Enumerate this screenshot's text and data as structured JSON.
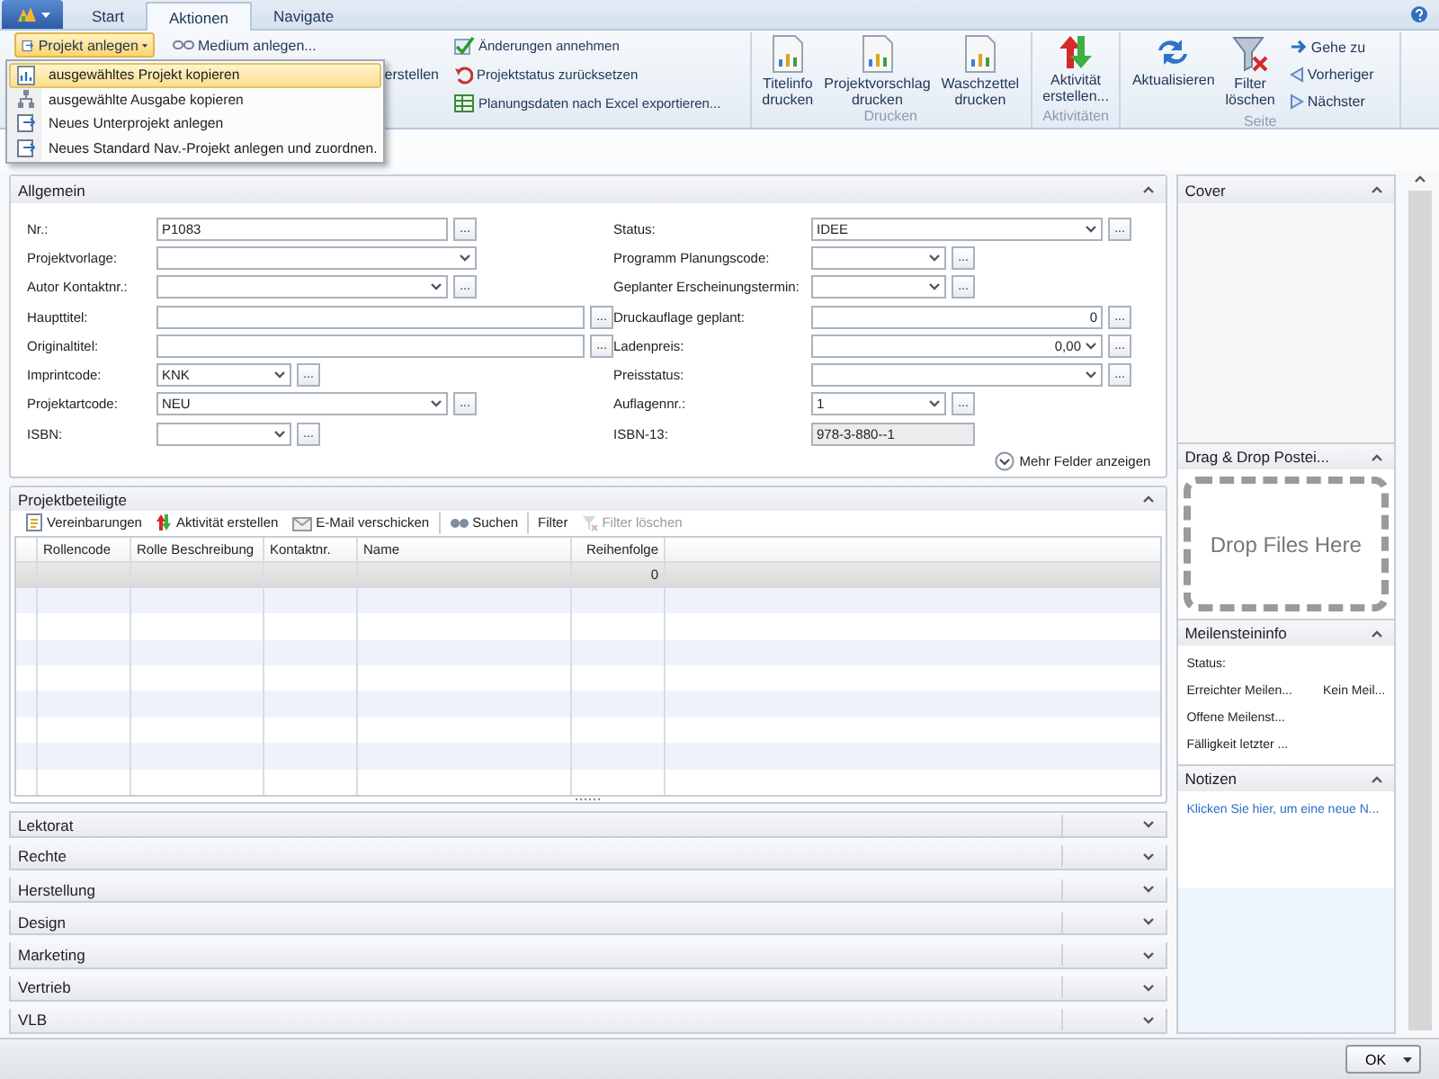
{
  "app_tabs": [
    {
      "label": "Start",
      "selected": false
    },
    {
      "label": "Aktionen",
      "selected": true
    },
    {
      "label": "Navigate",
      "selected": false
    }
  ],
  "ribbon": {
    "small_columns": [
      [
        {
          "label": "Projekt anlegen",
          "kind": "new-project",
          "highlighted": true
        }
      ],
      [
        {
          "label": "Medium anlegen...",
          "kind": "medium"
        },
        {
          "label": "erstellen",
          "kind": "text"
        }
      ],
      [
        {
          "label": "Änderungen annehmen",
          "kind": "accept"
        },
        {
          "label": "Projektstatus zurücksetzen",
          "kind": "reset"
        },
        {
          "label": "Planungsdaten nach Excel exportieren...",
          "kind": "excel"
        }
      ]
    ],
    "groups": [
      {
        "label": "Drucken",
        "items": [
          {
            "lines": [
              "Titelinfo",
              "drucken"
            ],
            "kind": "report"
          },
          {
            "lines": [
              "Projektvorschlag",
              "drucken"
            ],
            "kind": "report"
          },
          {
            "lines": [
              "Waschzettel",
              "drucken"
            ],
            "kind": "report"
          }
        ]
      },
      {
        "label": "Aktivitäten",
        "items": [
          {
            "lines": [
              "Aktivität",
              "erstellen..."
            ],
            "kind": "activity"
          }
        ]
      },
      {
        "label": "Seite",
        "items": [
          {
            "lines": [
              "Aktualisieren"
            ],
            "kind": "refresh"
          },
          {
            "lines": [
              "Filter",
              "löschen"
            ],
            "kind": "filter"
          }
        ],
        "small": [
          {
            "label": "Gehe zu",
            "kind": "goto"
          },
          {
            "label": "Vorheriger",
            "kind": "prev"
          },
          {
            "label": "Nächster",
            "kind": "next"
          }
        ]
      }
    ]
  },
  "menu": [
    {
      "label": "ausgewähltes Projekt kopieren",
      "kind": "copy",
      "highlighted": true
    },
    {
      "label": "ausgewählte Ausgabe kopieren",
      "kind": "tree",
      "highlighted": false
    },
    {
      "label": "Neues Unterprojekt anlegen",
      "kind": "new",
      "highlighted": false
    },
    {
      "label": "Neues Standard Nav.-Projekt anlegen und zuordnen.",
      "kind": "new",
      "highlighted": false
    }
  ],
  "sections": [
    {
      "kind": "form",
      "title": "Allgemein",
      "expanded": true,
      "left": [
        {
          "label": "Nr.:",
          "kind": "text",
          "value": "P1083",
          "lookup": "..."
        },
        {
          "label": "Projektvorlage:",
          "kind": "dropdown"
        },
        {
          "label": "Autor Kontaktnr.:",
          "kind": "dropdown",
          "lookup": "..."
        },
        {
          "label": "Haupttitel:",
          "kind": "text",
          "lookup": "..."
        },
        {
          "label": "Originaltitel:",
          "kind": "text",
          "lookup": "..."
        },
        {
          "label": "Imprintcode:",
          "kind": "dropdown",
          "value": "KNK",
          "lookup": "..."
        },
        {
          "label": "Projektartcode:",
          "kind": "dropdown",
          "value": "NEU",
          "lookup": "..."
        },
        {
          "label": "ISBN:",
          "kind": "dropdown",
          "lookup": "..."
        }
      ],
      "right": [
        {
          "label": "Status:",
          "kind": "dropdown",
          "value": "IDEE",
          "lookup": "..."
        },
        {
          "label": "Programm Planungscode:",
          "kind": "dropdown",
          "lookup": "..."
        },
        {
          "label": "Geplanter Erscheinungstermin:",
          "kind": "dropdown",
          "lookup": "..."
        },
        {
          "label": "Druckauflage geplant:",
          "kind": "text",
          "value": "0",
          "numeric": true,
          "lookup": "..."
        },
        {
          "label": "Ladenpreis:",
          "kind": "dropdown",
          "value": "0,00",
          "numeric": true,
          "lookup": "..."
        },
        {
          "label": "Preisstatus:",
          "kind": "dropdown",
          "lookup": "..."
        },
        {
          "label": "Auflagennr.:",
          "kind": "dropdown",
          "value": "1",
          "lookup": "..."
        },
        {
          "label": "ISBN-13:",
          "kind": "readonly",
          "value": "978-3-880--1"
        }
      ],
      "more": "Mehr Felder anzeigen"
    },
    {
      "kind": "grid",
      "title": "Projektbeteiligte",
      "expanded": true,
      "toolbar": [
        {
          "label": "Vereinbarungen",
          "kind": "agreements",
          "disabled": false
        },
        {
          "label": "Aktivität erstellen",
          "kind": "activity",
          "disabled": false
        },
        {
          "label": "E-Mail verschicken",
          "kind": "mail",
          "disabled": false
        },
        {
          "label": "Suchen",
          "kind": "search",
          "divider": true,
          "disabled": false
        },
        {
          "label": "Filter",
          "kind": "text",
          "divider": true,
          "disabled": false
        },
        {
          "label": "Filter löschen",
          "kind": "filter",
          "disabled": true
        }
      ],
      "columns": [
        "Rollencode",
        "Rolle Beschreibung",
        "Kontaktnr.",
        "Name",
        "Reihenfolge"
      ],
      "rows": [
        {
          "selected": true,
          "cells": [
            null,
            null,
            null,
            null,
            "0"
          ]
        }
      ]
    },
    {
      "kind": "group",
      "title": "Lektorat",
      "expanded": false
    },
    {
      "kind": "group",
      "title": "Rechte",
      "expanded": false
    },
    {
      "kind": "group",
      "title": "Herstellung",
      "expanded": false
    },
    {
      "kind": "group",
      "title": "Design",
      "expanded": false
    },
    {
      "kind": "group",
      "title": "Marketing",
      "expanded": false
    },
    {
      "kind": "group",
      "title": "Vertrieb",
      "expanded": false
    },
    {
      "kind": "group",
      "title": "VLB",
      "expanded": false
    }
  ],
  "factboxes": [
    {
      "kind": "empty",
      "title": "Cover",
      "expanded": true
    },
    {
      "kind": "dropzone",
      "title": "Drag & Drop Postei...",
      "expanded": true,
      "text": "Drop Files Here"
    },
    {
      "kind": "fields",
      "title": "Meilensteininfo",
      "expanded": true,
      "rows": [
        {
          "label": "Status:"
        },
        {
          "label": "Erreichter Meilen...",
          "value": "Kein Meil..."
        },
        {
          "label": "Offene Meilenst..."
        },
        {
          "label": "Fälligkeit letzter ..."
        }
      ]
    },
    {
      "kind": "link",
      "title": "Notizen",
      "expanded": true,
      "link": "Klicken Sie hier, um eine neue N..."
    }
  ],
  "footer": {
    "button": "OK"
  }
}
